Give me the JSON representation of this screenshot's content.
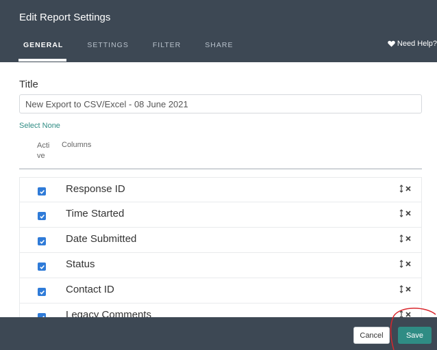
{
  "dialog": {
    "title": "Edit Report Settings",
    "help_label": "Need Help?",
    "tabs": [
      {
        "label": "GENERAL",
        "active": true
      },
      {
        "label": "SETTINGS",
        "active": false
      },
      {
        "label": "FILTER",
        "active": false
      },
      {
        "label": "SHARE",
        "active": false
      }
    ]
  },
  "form": {
    "title_label": "Title",
    "title_value": "New Export to CSV/Excel - 08 June 2021",
    "select_none": "Select None",
    "col_active": "Acti ve",
    "col_columns": "Columns"
  },
  "columns": [
    {
      "label": "Response ID",
      "checked": true
    },
    {
      "label": "Time Started",
      "checked": true
    },
    {
      "label": "Date Submitted",
      "checked": true
    },
    {
      "label": "Status",
      "checked": true
    },
    {
      "label": "Contact ID",
      "checked": true
    },
    {
      "label": "Legacy Comments",
      "checked": true
    }
  ],
  "footer": {
    "cancel_label": "Cancel",
    "save_label": "Save"
  },
  "colors": {
    "header_bg": "#3d4854",
    "accent": "#2f8c84",
    "checkbox": "#2f7bd8",
    "annotation": "#d9262c"
  },
  "icons": {
    "help": "heart-icon",
    "check": "check-icon",
    "drag": "drag-handle-icon",
    "remove": "remove-icon"
  }
}
